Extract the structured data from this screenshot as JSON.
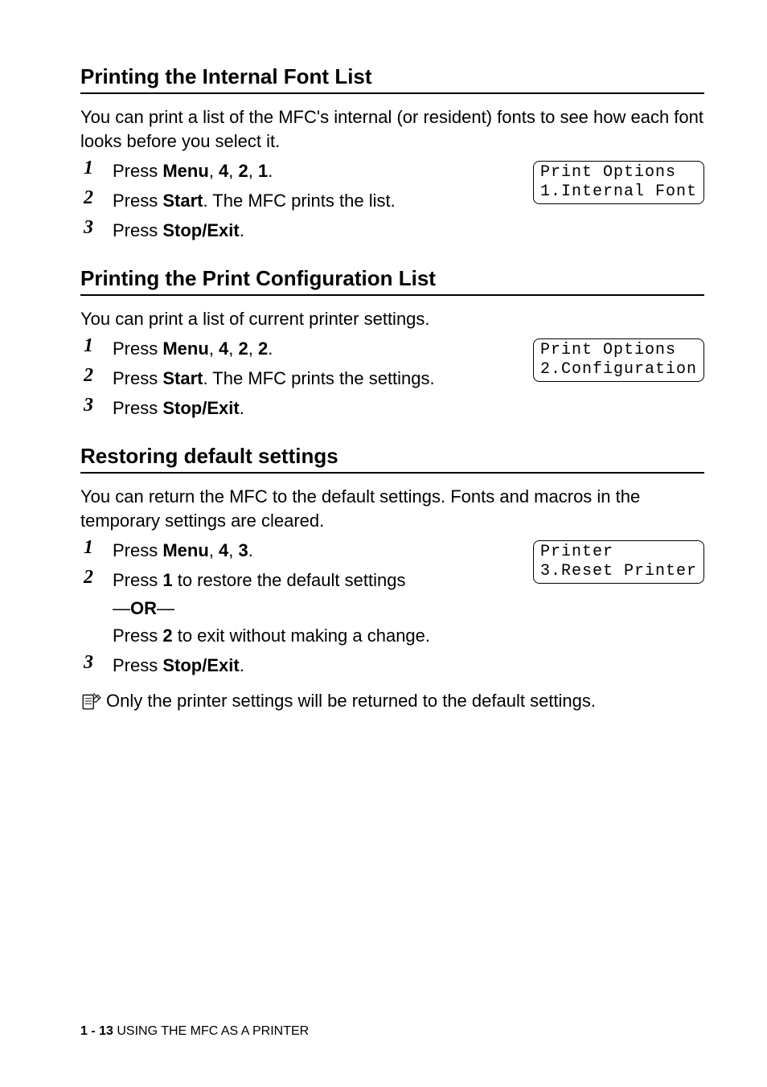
{
  "section1": {
    "heading": "Printing the Internal Font List",
    "intro": "You can print a list of the MFC's internal (or resident) fonts to see how each font looks before you select it.",
    "steps": {
      "s1_pre": "Press ",
      "s1_b1": "Menu",
      "s1_mid1": ", ",
      "s1_b2": "4",
      "s1_mid2": ", ",
      "s1_b3": "2",
      "s1_mid3": ", ",
      "s1_b4": "1",
      "s1_post": ".",
      "s2_pre": "Press ",
      "s2_b1": "Start",
      "s2_post": ". The MFC prints the list.",
      "s3_pre": "Press ",
      "s3_b1": "Stop/Exit",
      "s3_post": "."
    },
    "display_l1": "Print Options",
    "display_l2": "1.Internal Font"
  },
  "section2": {
    "heading": "Printing the Print Configuration List",
    "intro": "You can print a list of current printer settings.",
    "steps": {
      "s1_pre": "Press ",
      "s1_b1": "Menu",
      "s1_mid1": ", ",
      "s1_b2": "4",
      "s1_mid2": ", ",
      "s1_b3": "2",
      "s1_mid3": ", ",
      "s1_b4": "2",
      "s1_post": ".",
      "s2_pre": "Press ",
      "s2_b1": "Start",
      "s2_post": ". The MFC prints the settings.",
      "s3_pre": "Press ",
      "s3_b1": "Stop/Exit",
      "s3_post": "."
    },
    "display_l1": "Print Options",
    "display_l2": "2.Configuration"
  },
  "section3": {
    "heading": "Restoring default settings",
    "intro": "You can return the MFC to the default settings. Fonts and macros in the temporary settings are cleared.",
    "steps": {
      "s1_pre": "Press ",
      "s1_b1": "Menu",
      "s1_mid1": ", ",
      "s1_b2": "4",
      "s1_mid2": ", ",
      "s1_b3": "3",
      "s1_post": ".",
      "s2_pre": "Press ",
      "s2_b1": "1",
      "s2_post": " to restore the default settings",
      "or_pre": "—",
      "or_b": "OR",
      "or_post": "—",
      "sub_pre": "Press ",
      "sub_b1": "2",
      "sub_post": " to exit without making a change.",
      "s3_pre": "Press ",
      "s3_b1": "Stop/Exit",
      "s3_post": "."
    },
    "display_l1": "Printer",
    "display_l2": "3.Reset Printer",
    "note": "Only the printer settings will be returned to the default settings."
  },
  "step_numbers": {
    "n1": "1",
    "n2": "2",
    "n3": "3"
  },
  "footer": {
    "page": "1 - 13",
    "sep": "   ",
    "title": "USING THE MFC AS A PRINTER"
  }
}
